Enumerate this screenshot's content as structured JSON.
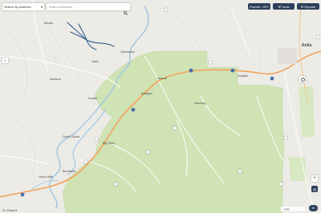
{
  "toolbar": {
    "search_by_label": "Search by Address",
    "search_placeholder": "Search Address...",
    "parcels_label": "Parcels",
    "parcels_value": "OFF",
    "tools_label": "Tools",
    "reports_label": "Reports"
  },
  "map": {
    "towns": {
      "rolla": "Rolla",
      "st_robert": "St. Robert",
      "newburg": "Newburg",
      "doolittle": "Doolittle",
      "arlington": "Arlington",
      "jerome": "Jerome",
      "devils_elbow": "Devil's Elbow",
      "hooker": "Hooker",
      "big_piney": "Big Piney",
      "yancy_mills": "Yancy Mills",
      "bloodland": "Bloodland",
      "clementine": "Clementine",
      "beulah": "Beulah",
      "kaintuck": "Kaintuck",
      "tralle": "Tralle"
    },
    "scale_text": "2 km",
    "badge_text": "90",
    "footer_text": "Leaflet | OpenStreetMap"
  },
  "colors": {
    "base": "#ecebe6",
    "forest": "#cfe3b4",
    "water": "#9ec6e4",
    "interstate": "#f2a35c",
    "toolbar_dark": "#2c3e5a"
  }
}
